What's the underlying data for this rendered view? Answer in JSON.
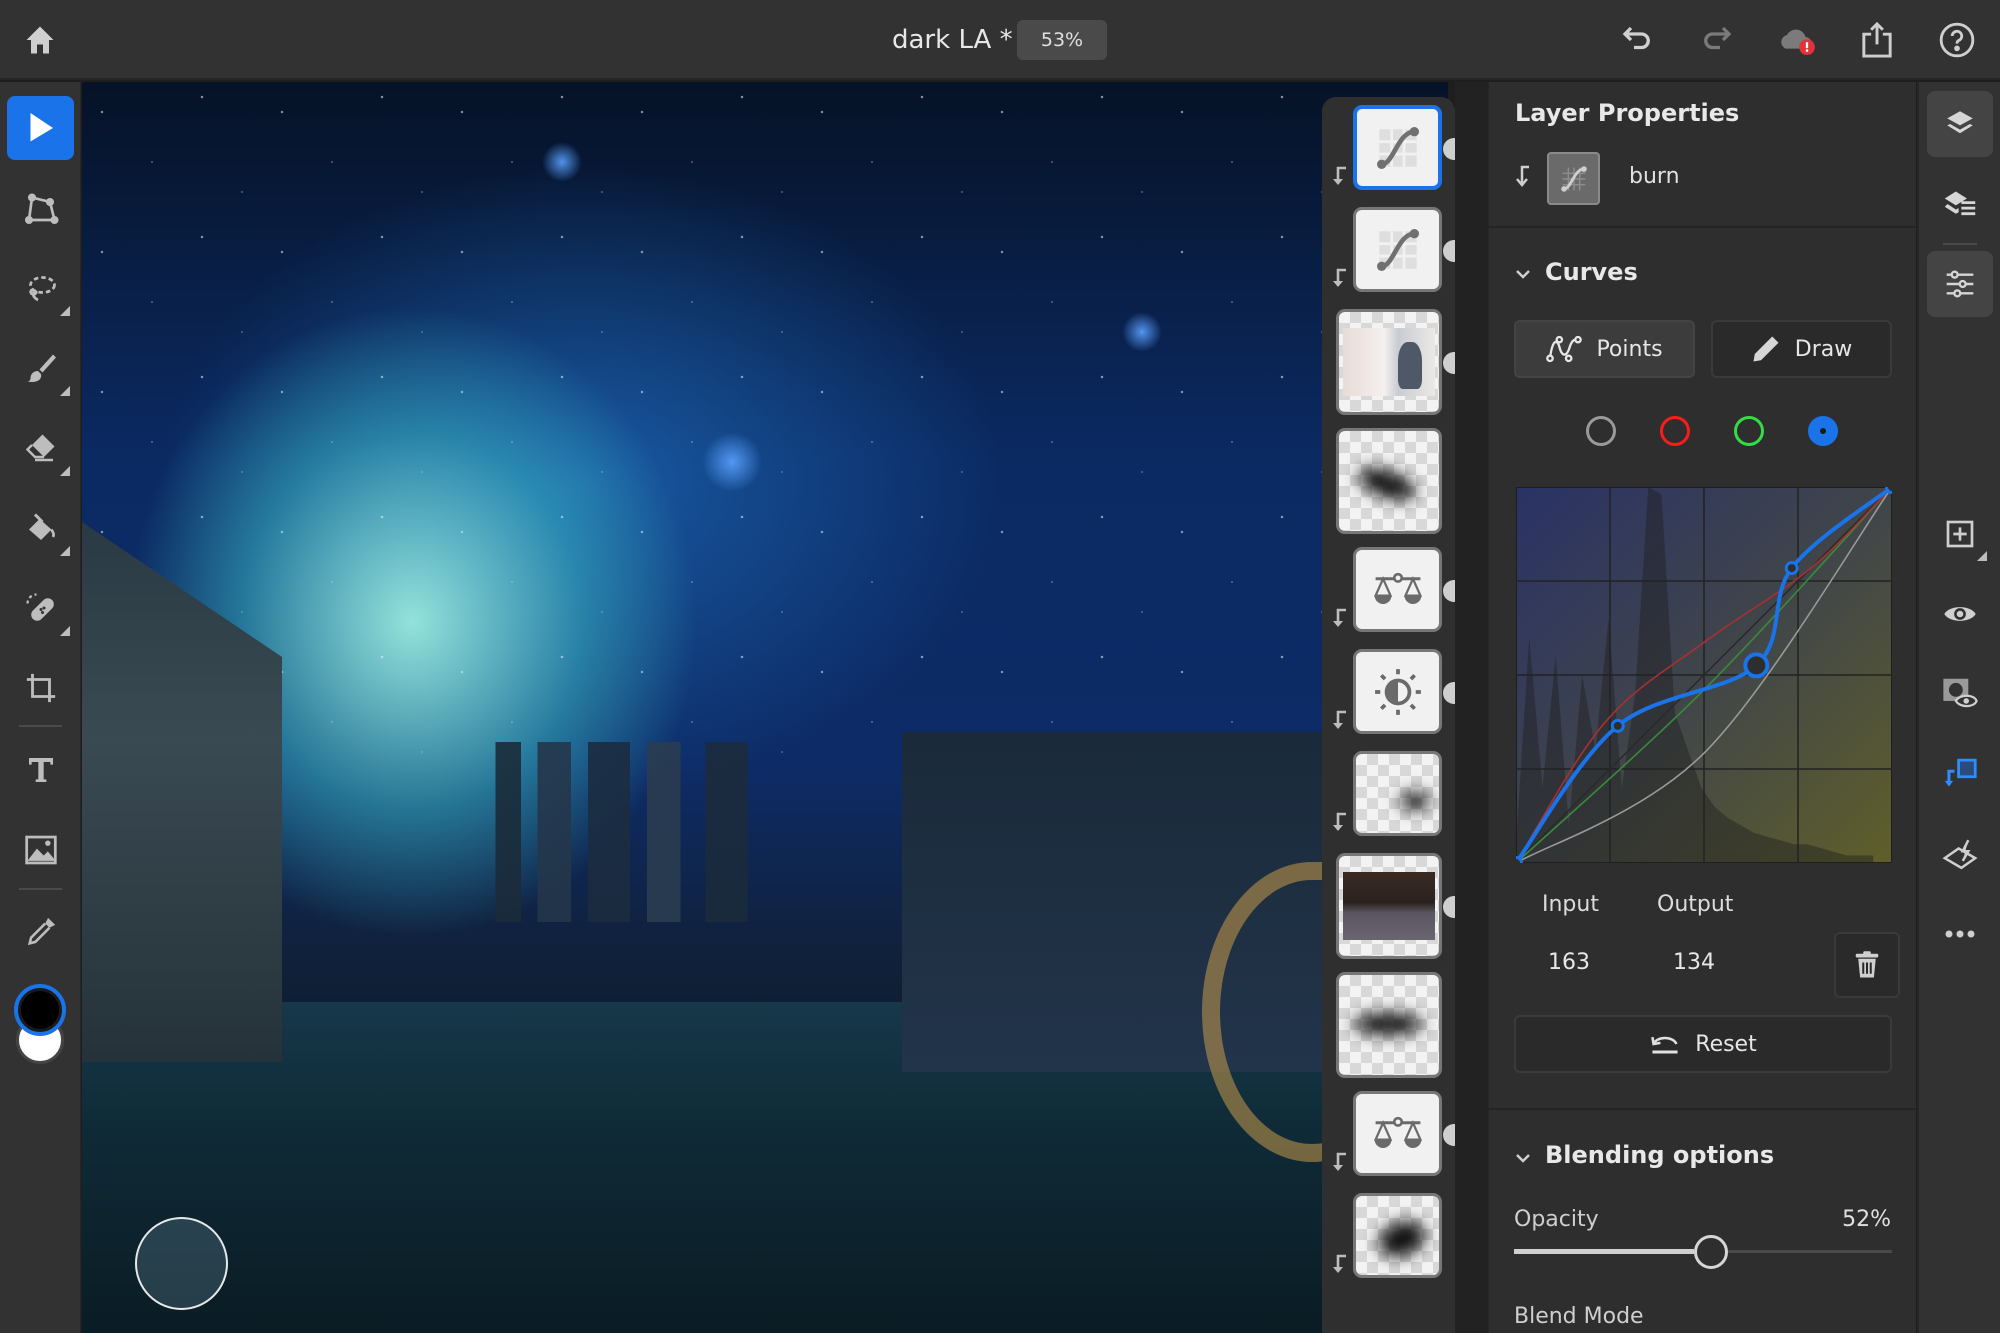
{
  "topbar": {
    "document_title": "dark LA *",
    "zoom_level": "53%",
    "icons": [
      "home-icon",
      "undo-icon",
      "redo-icon",
      "cloud-sync-error-icon",
      "share-icon",
      "help-icon"
    ]
  },
  "toolbar": {
    "tools": [
      {
        "name": "select",
        "icon": "move-arrow-icon",
        "active": true
      },
      {
        "name": "transform",
        "icon": "transform-icon",
        "active": false
      },
      {
        "name": "lasso",
        "icon": "lasso-icon",
        "active": false,
        "has_submenu": true
      },
      {
        "name": "brush",
        "icon": "brush-icon",
        "active": false,
        "has_submenu": true
      },
      {
        "name": "eraser",
        "icon": "eraser-icon",
        "active": false,
        "has_submenu": true
      },
      {
        "name": "fill",
        "icon": "paint-bucket-icon",
        "active": false,
        "has_submenu": true
      },
      {
        "name": "heal",
        "icon": "healing-icon",
        "active": false,
        "has_submenu": true
      },
      {
        "name": "crop",
        "icon": "crop-icon",
        "active": false
      },
      {
        "name": "type",
        "icon": "type-icon",
        "active": false
      },
      {
        "name": "place-image",
        "icon": "image-icon",
        "active": false
      },
      {
        "name": "eyedropper",
        "icon": "eyedropper-icon",
        "active": false
      }
    ],
    "foreground_color": "#000000",
    "background_color": "#ffffff"
  },
  "layers": [
    {
      "type": "adjustment",
      "kind": "curves",
      "clipped": true,
      "selected": true,
      "has_mask_handle": true
    },
    {
      "type": "adjustment",
      "kind": "curves",
      "clipped": true,
      "selected": false,
      "has_mask_handle": true
    },
    {
      "type": "pixel",
      "kind": "photo-boy-window",
      "clipped": false,
      "selected": false,
      "has_mask_handle": true
    },
    {
      "type": "pixel",
      "kind": "shadow-brush",
      "clipped": false,
      "selected": false,
      "has_mask_handle": false
    },
    {
      "type": "adjustment",
      "kind": "color-balance",
      "clipped": true,
      "selected": false,
      "has_mask_handle": true
    },
    {
      "type": "adjustment",
      "kind": "brightness-contrast",
      "clipped": true,
      "selected": false,
      "has_mask_handle": true
    },
    {
      "type": "pixel",
      "kind": "shadow-smudge",
      "clipped": true,
      "selected": false,
      "has_mask_handle": false
    },
    {
      "type": "pixel",
      "kind": "photo-living-room",
      "clipped": false,
      "selected": false,
      "has_mask_handle": true
    },
    {
      "type": "pixel",
      "kind": "shadow-brush-2",
      "clipped": false,
      "selected": false,
      "has_mask_handle": false
    },
    {
      "type": "adjustment",
      "kind": "color-balance",
      "clipped": true,
      "selected": false,
      "has_mask_handle": true
    },
    {
      "type": "pixel",
      "kind": "shadow-blob",
      "clipped": true,
      "selected": false,
      "has_mask_handle": false
    }
  ],
  "properties": {
    "title": "Layer Properties",
    "layer_name": "burn",
    "curves": {
      "section_title": "Curves",
      "mode_buttons": {
        "points": "Points",
        "draw": "Draw"
      },
      "channels": [
        {
          "name": "rgb",
          "color": "#9a9a9a",
          "selected": false
        },
        {
          "name": "red",
          "color": "#ff1a1a",
          "selected": false
        },
        {
          "name": "green",
          "color": "#33dd44",
          "selected": false
        },
        {
          "name": "blue",
          "color": "#1a73e8",
          "selected": true
        }
      ],
      "input_label": "Input",
      "output_label": "Output",
      "input_value": "163",
      "output_value": "134",
      "reset_label": "Reset"
    },
    "blending": {
      "section_title": "Blending options",
      "opacity_label": "Opacity",
      "opacity_value": "52%",
      "opacity_fraction": 0.52,
      "blend_mode_label": "Blend Mode"
    }
  },
  "chart_data": {
    "type": "line",
    "title": "Curves",
    "xlabel": "Input",
    "ylabel": "Output",
    "xlim": [
      0,
      255
    ],
    "ylim": [
      0,
      255
    ],
    "grid": true,
    "selected_point": {
      "input": 163,
      "output": 134
    },
    "series": [
      {
        "name": "Blue",
        "color": "#1a73e8",
        "points": [
          [
            0,
            0
          ],
          [
            69,
            93
          ],
          [
            163,
            134
          ],
          [
            187,
            200
          ],
          [
            255,
            255
          ]
        ],
        "editable": true
      },
      {
        "name": "Red",
        "color": "#a83030",
        "points": [
          [
            0,
            0
          ],
          [
            60,
            95
          ],
          [
            128,
            150
          ],
          [
            200,
            200
          ],
          [
            255,
            255
          ]
        ]
      },
      {
        "name": "Green",
        "color": "#3a8a3a",
        "points": [
          [
            0,
            0
          ],
          [
            128,
            118
          ],
          [
            255,
            255
          ]
        ]
      },
      {
        "name": "RGB",
        "color": "#9a9a9a",
        "points": [
          [
            0,
            0
          ],
          [
            128,
            75
          ],
          [
            255,
            255
          ]
        ]
      },
      {
        "name": "Baseline",
        "color": "#2a2a2a",
        "points": [
          [
            0,
            0
          ],
          [
            255,
            255
          ]
        ]
      }
    ]
  },
  "right_rail": {
    "buttons": [
      {
        "icon": "layers-icon",
        "active": true
      },
      {
        "icon": "layer-properties-icon",
        "active": false
      },
      {
        "icon": "adjustments-sliders-icon",
        "active": true
      },
      {
        "icon": "add-layer-icon",
        "active": false
      },
      {
        "icon": "visibility-eye-icon",
        "active": false
      },
      {
        "icon": "mask-visibility-icon",
        "active": false
      },
      {
        "icon": "clipping-mask-icon",
        "active": true
      },
      {
        "icon": "quick-actions-icon",
        "active": false
      },
      {
        "icon": "more-icon",
        "active": false
      }
    ]
  }
}
